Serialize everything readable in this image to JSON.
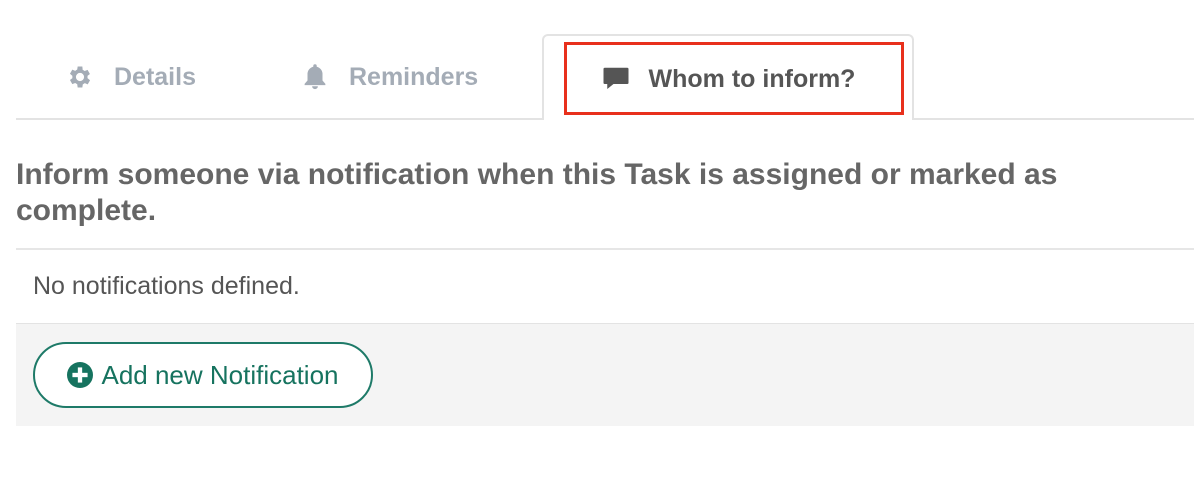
{
  "tabs": [
    {
      "label": "Details",
      "icon": "gear-icon",
      "active": false
    },
    {
      "label": "Reminders",
      "icon": "bell-icon",
      "active": false
    },
    {
      "label": "Whom to inform?",
      "icon": "comment-icon",
      "active": true
    }
  ],
  "main": {
    "heading": "Inform someone via notification when this Task is assigned or marked as complete.",
    "empty_text": "No notifications defined.",
    "add_button_label": "Add new Notification"
  },
  "colors": {
    "highlight": "#e8301c",
    "accent": "#16735f",
    "tab_inactive": "#a4acb6",
    "tab_active": "#555555"
  }
}
